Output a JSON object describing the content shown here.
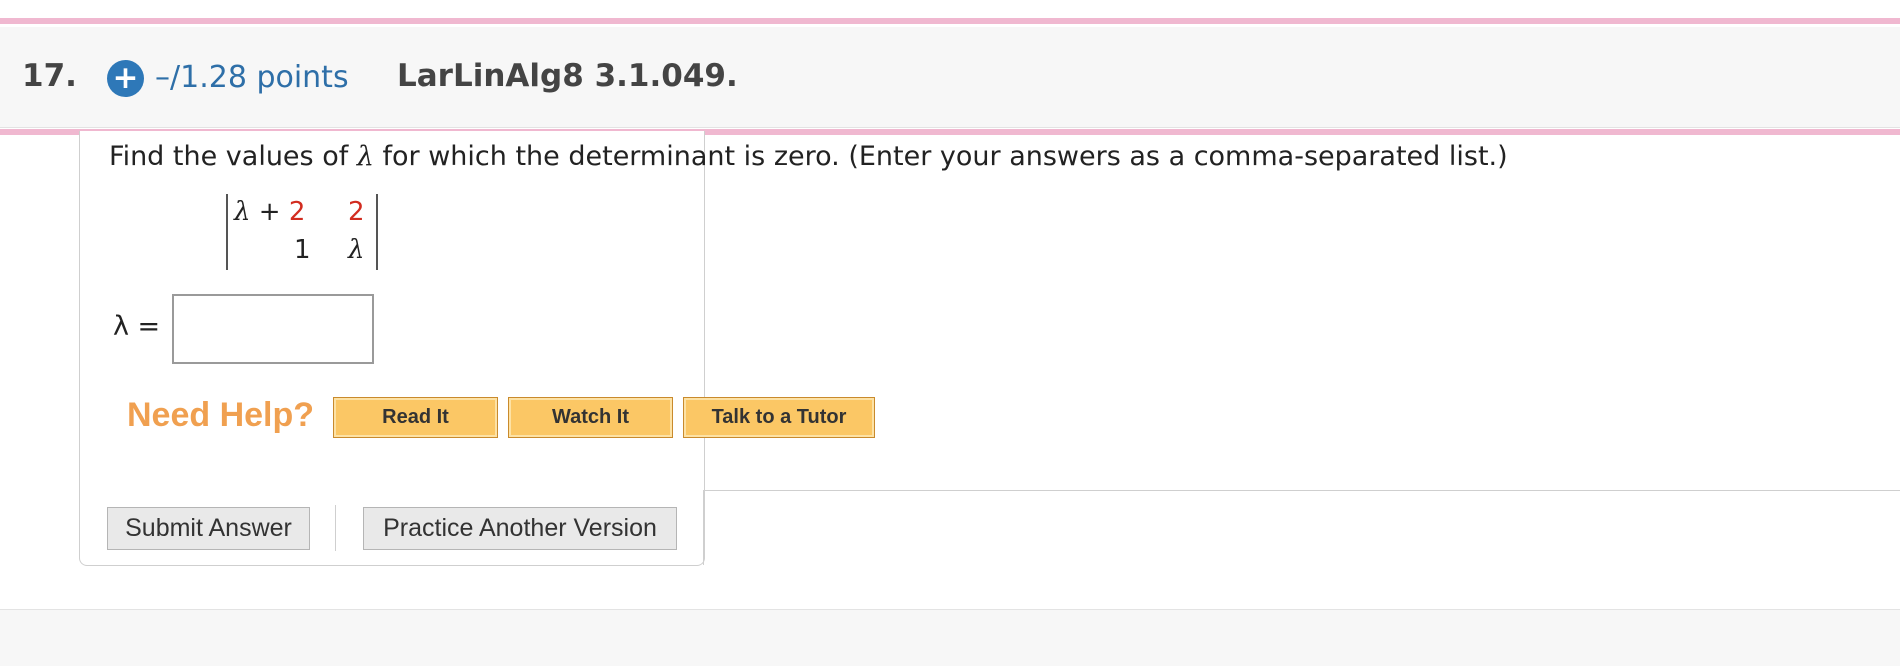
{
  "header": {
    "question_number": "17.",
    "points": "–/1.28 points",
    "reference": "LarLinAlg8 3.1.049."
  },
  "question": {
    "prompt_before": "Find the values of ",
    "lambda": "λ",
    "prompt_after": " for which the determinant is zero. (Enter your answers as a comma-separated list.)",
    "determinant": {
      "r1c1_lambda": "λ",
      "r1c1_op": " + ",
      "r1c1_const": "2",
      "r1c2": "2",
      "r2c1": "1",
      "r2c2": "λ"
    },
    "answer_label": "λ =",
    "answer_value": ""
  },
  "help": {
    "title": "Need Help?",
    "read_it": "Read It",
    "watch_it": "Watch It",
    "talk_to_tutor": "Talk to a Tutor"
  },
  "actions": {
    "submit": "Submit Answer",
    "practice": "Practice Another Version"
  },
  "colors": {
    "accent_pink": "#f0b8d0",
    "link_blue": "#2e6fa8",
    "highlight_red": "#d22c20",
    "help_orange": "#f0a050",
    "help_button": "#fbc765"
  },
  "icons": {
    "add": "plus-circle-icon"
  }
}
